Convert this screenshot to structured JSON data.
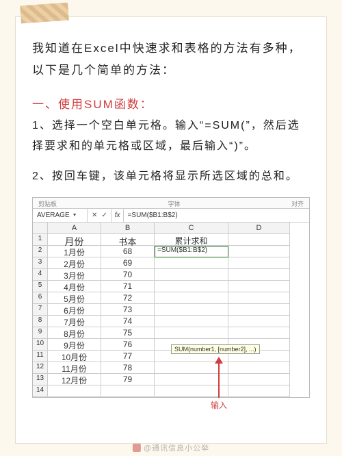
{
  "intro": "我知道在Excel中快速求和表格的方法有多种，以下是几个简单的方法：",
  "section1": {
    "title": "一、使用SUM函数：",
    "step1": "1、选择一个空白单元格。输入“=SUM(”，然后选择要求和的单元格或区域，最后输入“)”。",
    "step2": "2、按回车键，该单元格将显示所选区域的总和。"
  },
  "screenshot": {
    "ribbon_left": "剪贴板",
    "ribbon_mid": "字体",
    "ribbon_right": "对齐",
    "namebox": "AVERAGE",
    "fx": "fx",
    "formula": "=SUM($B1:B$2)",
    "tooltip": "SUM(number1, [number2], ...)",
    "arrow_label": "输入",
    "cols": {
      "A": "A",
      "B": "B",
      "C": "C",
      "D": "D"
    },
    "headers": {
      "A": "月份",
      "B": "书本",
      "C": "累计求和"
    },
    "c2_formula": "=SUM($B1:B$2)"
  },
  "chart_data": {
    "type": "table",
    "title": "",
    "columns": [
      "月份",
      "书本",
      "累计求和"
    ],
    "rows": [
      {
        "月份": "1月份",
        "书本": 68,
        "累计求和": "=SUM($B1:B$2)"
      },
      {
        "月份": "2月份",
        "书本": 69,
        "累计求和": ""
      },
      {
        "月份": "3月份",
        "书本": 70,
        "累计求和": ""
      },
      {
        "月份": "4月份",
        "书本": 71,
        "累计求和": ""
      },
      {
        "月份": "5月份",
        "书本": 72,
        "累计求和": ""
      },
      {
        "月份": "6月份",
        "书本": 73,
        "累计求和": ""
      },
      {
        "月份": "7月份",
        "书本": 74,
        "累计求和": ""
      },
      {
        "月份": "8月份",
        "书本": 75,
        "累计求和": ""
      },
      {
        "月份": "9月份",
        "书本": 76,
        "累计求和": ""
      },
      {
        "月份": "10月份",
        "书本": 77,
        "累计求和": ""
      },
      {
        "月份": "11月份",
        "书本": 78,
        "累计求和": ""
      },
      {
        "月份": "12月份",
        "书本": 79,
        "累计求和": ""
      }
    ]
  },
  "watermark": "@通讯信息小公举"
}
